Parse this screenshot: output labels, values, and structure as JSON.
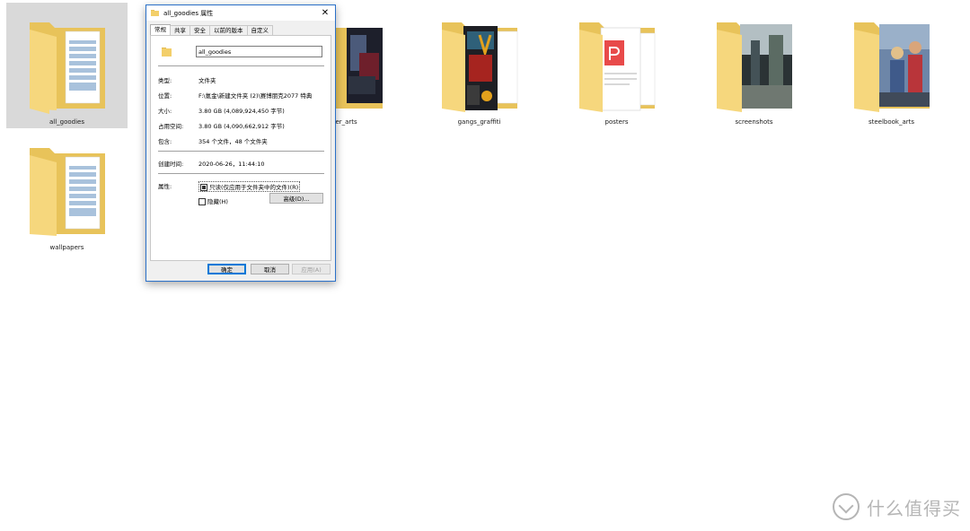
{
  "folders": [
    {
      "name": "all_goodies",
      "selected": true,
      "preview": "documents"
    },
    {
      "name": "cover_arts",
      "label_visible": "ver_arts",
      "selected": false,
      "preview": "cover-art-dark"
    },
    {
      "name": "gangs_graffiti",
      "selected": false,
      "preview": "graffiti-art"
    },
    {
      "name": "posters",
      "selected": false,
      "preview": "pdf-documents"
    },
    {
      "name": "screenshots",
      "selected": false,
      "preview": "game-screenshot"
    },
    {
      "name": "steelbook_arts",
      "selected": false,
      "preview": "steelbook-poster"
    },
    {
      "name": "wallpapers",
      "selected": false,
      "preview": "documents"
    }
  ],
  "dialog": {
    "title": "all_goodies 属性",
    "close_glyph": "✕",
    "tabs": [
      "常规",
      "共享",
      "安全",
      "以前的版本",
      "自定义"
    ],
    "active_tab": "常规",
    "folder_name": "all_goodies",
    "fields": {
      "type_label": "类型:",
      "type_value": "文件夹",
      "location_label": "位置:",
      "location_value": "F:\\氪金\\新建文件夹 (2)\\赛博朋克2077 特典",
      "size_label": "大小:",
      "size_value": "3.80 GB (4,089,924,450 字节)",
      "disk_label": "占用空间:",
      "disk_value": "3.80 GB (4,090,662,912 字节)",
      "contains_label": "包含:",
      "contains_value": "354 个文件，48 个文件夹",
      "created_label": "创建时间:",
      "created_value": "2020-06-26，11:44:10",
      "attributes_label": "属性:"
    },
    "attributes": {
      "readonly_label": "只读(仅应用于文件夹中的文件)(R)",
      "readonly_state": "indeterminate",
      "hidden_label": "隐藏(H)",
      "hidden_state": "unchecked",
      "advanced_button": "高级(D)..."
    },
    "buttons": {
      "ok": "确定",
      "cancel": "取消",
      "apply": "应用(A)"
    }
  },
  "watermark": {
    "text": "什么值得买"
  },
  "colors": {
    "folder_back": "#e8c35a",
    "folder_front": "#f6d77d",
    "selection": "#d9d9d9",
    "dialog_accent": "#0078d7"
  }
}
